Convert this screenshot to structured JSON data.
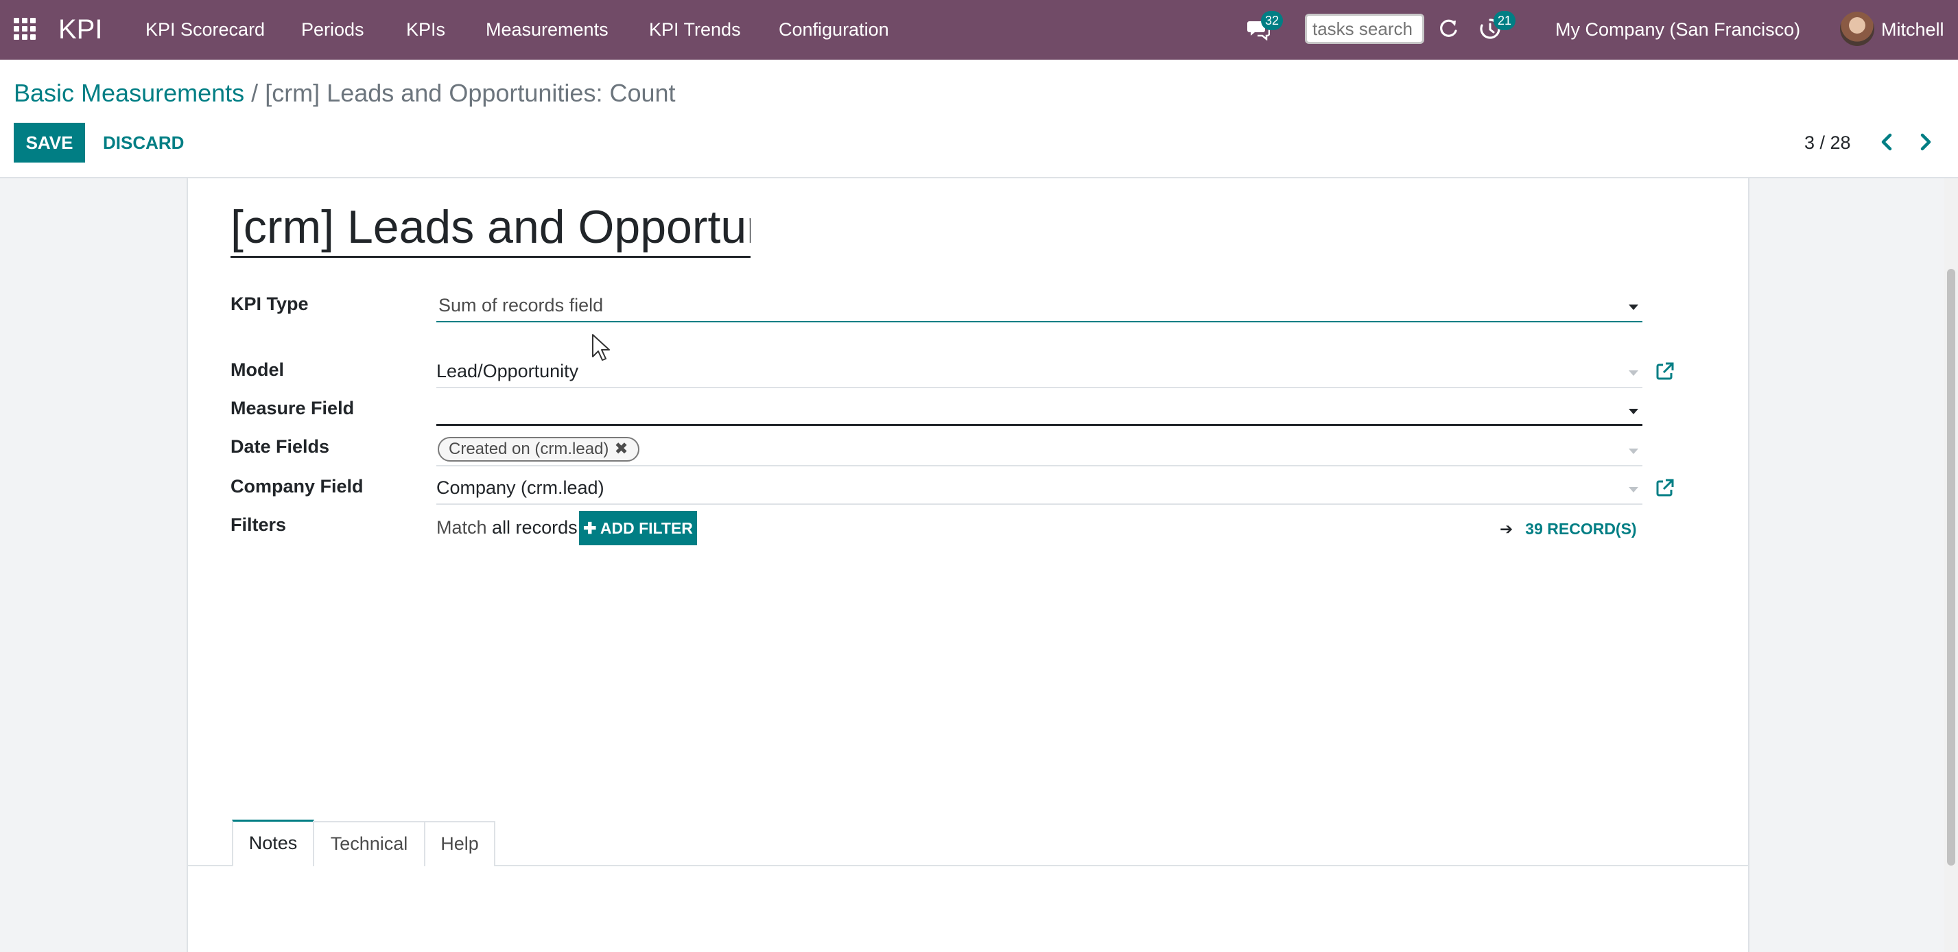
{
  "navbar": {
    "brand": "KPI",
    "menu": [
      "KPI Scorecard",
      "Periods",
      "KPIs",
      "Measurements",
      "KPI Trends",
      "Configuration"
    ],
    "messages_count": "32",
    "search_placeholder": "tasks search",
    "activities_count": "21",
    "company": "My Company (San Francisco)",
    "user": "Mitchell",
    "icons": [
      "apps-grid-icon",
      "chat-icon",
      "refresh-icon",
      "activity-clock-icon",
      "avatar"
    ]
  },
  "breadcrumb": {
    "parent": "Basic Measurements",
    "separator": "/",
    "current": "[crm] Leads and Opportunities: Count"
  },
  "actions": {
    "save": "SAVE",
    "discard": "DISCARD"
  },
  "pager": {
    "value": "3 / 28"
  },
  "form": {
    "title": "[crm] Leads and Opportur",
    "kpi_type": {
      "label": "KPI Type",
      "value": "Sum of records field"
    },
    "model": {
      "label": "Model",
      "value": "Lead/Opportunity"
    },
    "measure_field": {
      "label": "Measure Field",
      "value": ""
    },
    "date_fields": {
      "label": "Date Fields",
      "tags": [
        "Created on (crm.lead)"
      ]
    },
    "company_field": {
      "label": "Company Field",
      "value": "Company (crm.lead)"
    },
    "filters": {
      "label": "Filters",
      "match_prefix": "Match",
      "match_value": "all records",
      "add_filter": "ADD FILTER",
      "records": "39 RECORD(S)"
    }
  },
  "tabs": [
    "Notes",
    "Technical",
    "Help"
  ],
  "colors": {
    "navbar": "#714b67",
    "accent": "#017e84",
    "badge": "#017e84"
  }
}
